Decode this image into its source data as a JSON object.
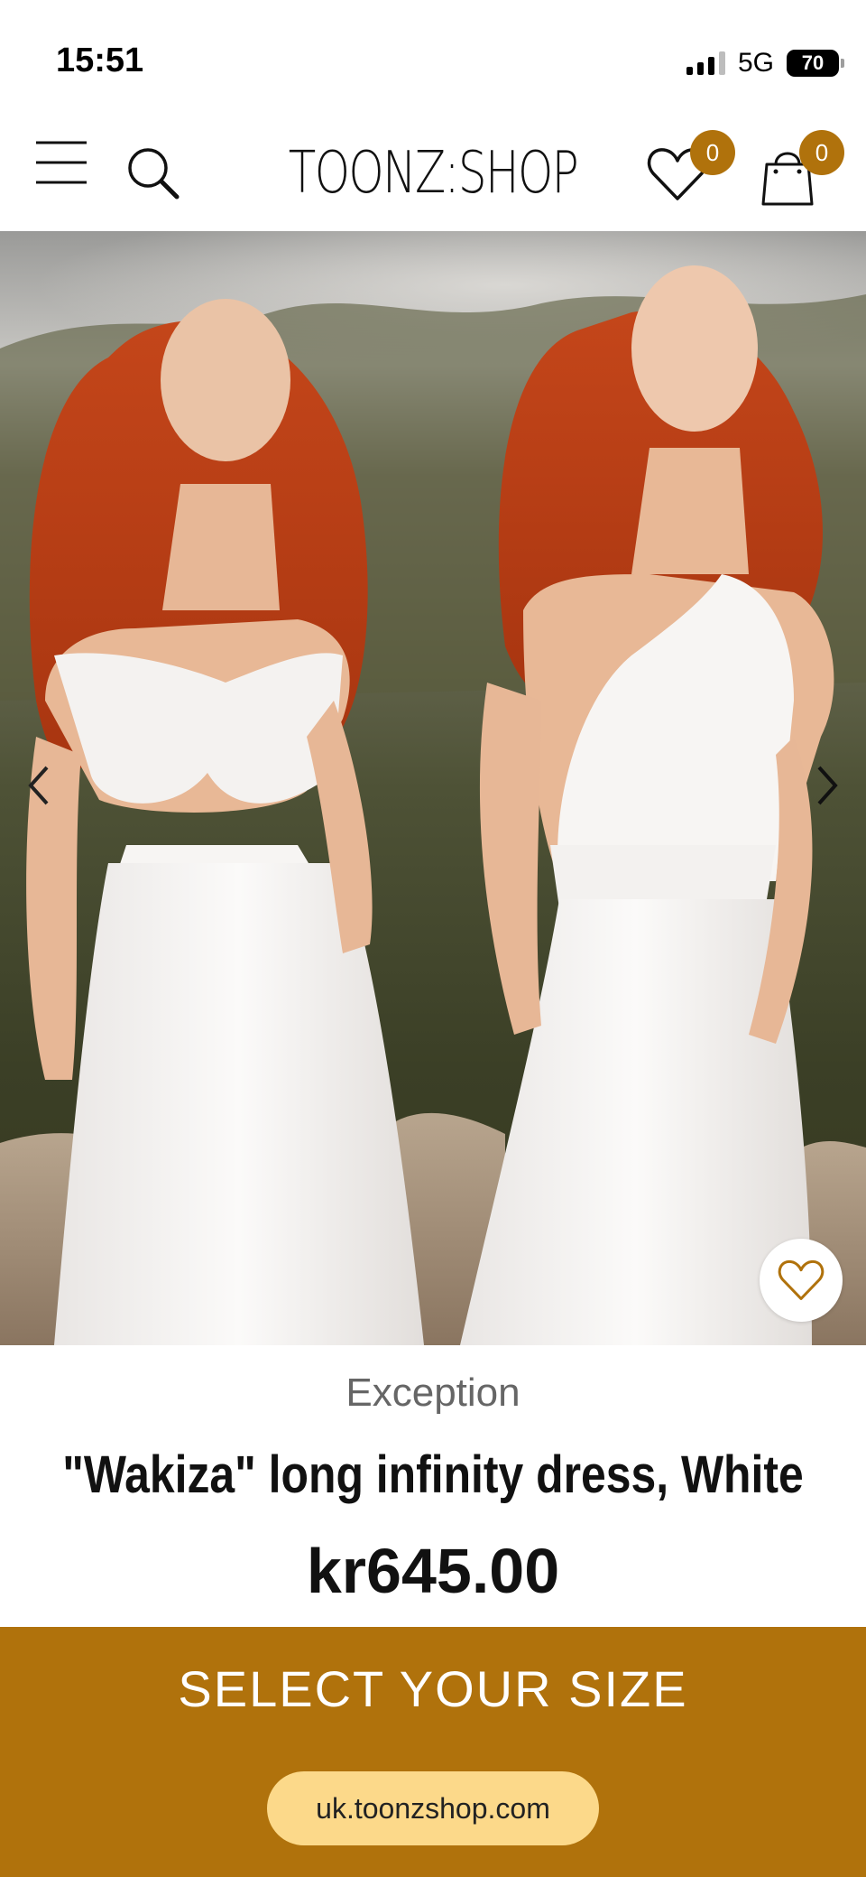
{
  "status_bar": {
    "time": "15:51",
    "network": "5G",
    "battery": "70"
  },
  "header": {
    "logo_text": "TOONZ:SHOP",
    "wishlist_count": "0",
    "cart_count": "0",
    "icons": [
      "menu-icon",
      "search-icon",
      "heart-icon",
      "shopping-bag-icon"
    ]
  },
  "product": {
    "image_icons": [
      "chevron-left-icon",
      "chevron-right-icon",
      "heart-icon"
    ],
    "brand": "Exception",
    "title": "\"Wakiza\" long infinity dress, White",
    "price": "kr645.00"
  },
  "cta": {
    "select_size_label": "SELECT YOUR SIZE"
  },
  "browser": {
    "url": "uk.toonzshop.com"
  },
  "colors": {
    "accent": "#b0720c",
    "url_pill": "#fcd98a"
  }
}
